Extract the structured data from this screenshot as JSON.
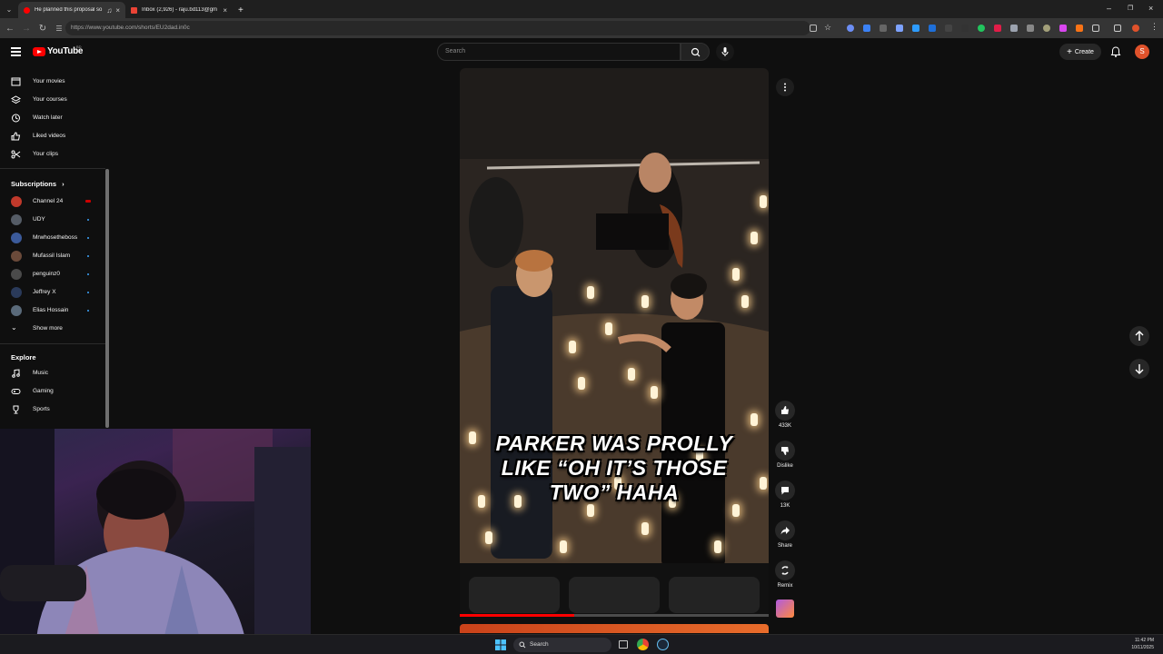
{
  "browser": {
    "tabs": [
      {
        "title": "He planned this proposal so",
        "active": true,
        "favicon_color": "#ff0000"
      },
      {
        "title": "Inbox (2,926) - raju.bd113@gm",
        "active": false,
        "favicon_color": "#ea4335"
      }
    ],
    "new_tab": "+",
    "url": "https://www.youtube.com/shorts/EU2dad.in0c"
  },
  "youtube": {
    "logo_text": "YouTube",
    "logo_sup": "BD",
    "search_placeholder": "Search",
    "create_label": "Create",
    "avatar_letter": "S"
  },
  "sidebar": {
    "top_items": [
      {
        "label": "Your movies",
        "icon": "movies-icon"
      },
      {
        "label": "Your courses",
        "icon": "courses-icon"
      },
      {
        "label": "Watch later",
        "icon": "clock-icon"
      },
      {
        "label": "Liked videos",
        "icon": "thumbs-up-icon"
      },
      {
        "label": "Your clips",
        "icon": "scissors-icon"
      }
    ],
    "subscriptions_title": "Subscriptions",
    "subscriptions": [
      {
        "label": "Channel 24",
        "avatar_color": "#c0392b",
        "badge": "live"
      },
      {
        "label": "UDY",
        "avatar_color": "#555c66",
        "badge": "dot"
      },
      {
        "label": "Mrwhosetheboss",
        "avatar_color": "#3b5a9a",
        "badge": "dot"
      },
      {
        "label": "Mufassil Islam",
        "avatar_color": "#6b4a3a",
        "badge": "dot"
      },
      {
        "label": "penguinz0",
        "avatar_color": "#4a4a4a",
        "badge": "dot"
      },
      {
        "label": "Jeffrey X",
        "avatar_color": "#2a3a5a",
        "badge": "dot"
      },
      {
        "label": "Elias Hossain",
        "avatar_color": "#5a6a7a",
        "badge": "dot"
      }
    ],
    "show_more": "Show more",
    "explore_title": "Explore",
    "explore": [
      {
        "label": "Music",
        "icon": "music-icon"
      },
      {
        "label": "Gaming",
        "icon": "gamepad-icon"
      },
      {
        "label": "Sports",
        "icon": "trophy-icon"
      }
    ]
  },
  "short": {
    "caption_lines": [
      "PARKER WAS PROLLY",
      "LIKE “OH IT’S THOSE",
      "TWO” HAHA"
    ],
    "progress": 0.37,
    "actions": {
      "like_count": "433K",
      "dislike_label": "Dislike",
      "comments_count": "13K",
      "share_label": "Share",
      "remix_label": "Remix"
    }
  },
  "taskbar": {
    "search_label": "Search",
    "time": "11:42 PM",
    "date": "10/11/2025"
  },
  "colors": {
    "brand_red": "#ff0000",
    "accent_blue": "#3ea6ff",
    "page_bg": "#0f0f0f"
  }
}
